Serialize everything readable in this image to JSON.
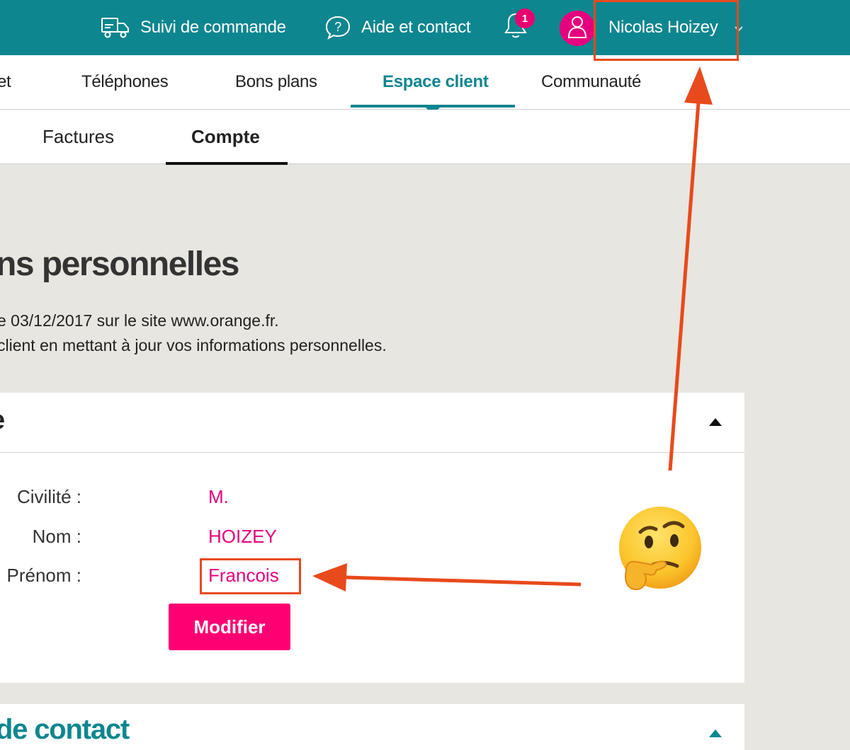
{
  "topbar": {
    "order_tracking": "Suivi de commande",
    "help_contact": "Aide et contact",
    "notification_count": "1",
    "user_name": "Nicolas Hoizey"
  },
  "main_nav": {
    "items": [
      {
        "label": "et"
      },
      {
        "label": "Téléphones"
      },
      {
        "label": "Bons plans"
      },
      {
        "label": "Espace client"
      },
      {
        "label": "Communauté"
      }
    ],
    "active": "Espace client"
  },
  "sub_nav": {
    "items": [
      {
        "label": "Factures"
      },
      {
        "label": "Compte"
      }
    ],
    "active": "Compte"
  },
  "page": {
    "title": "ns personnelles",
    "intro_line1": "e 03/12/2017 sur le site www.orange.fr.",
    "intro_line2": " client en mettant à jour vos informations personnelles."
  },
  "identity_card": {
    "title": "e",
    "fields": [
      {
        "label": "Civilité :",
        "value": "M."
      },
      {
        "label": "Nom :",
        "value": "HOIZEY"
      },
      {
        "label": "Prénom :",
        "value": "Francois"
      }
    ],
    "modify_label": "Modifier"
  },
  "contact_card": {
    "title": "de contact"
  },
  "annotations": {
    "color": "#e84a1c",
    "emoji": "thinking-face"
  },
  "colors": {
    "teal": "#0e868f",
    "magenta": "#e5007e",
    "button_pink": "#ff0073",
    "background": "#e8e6e0"
  }
}
